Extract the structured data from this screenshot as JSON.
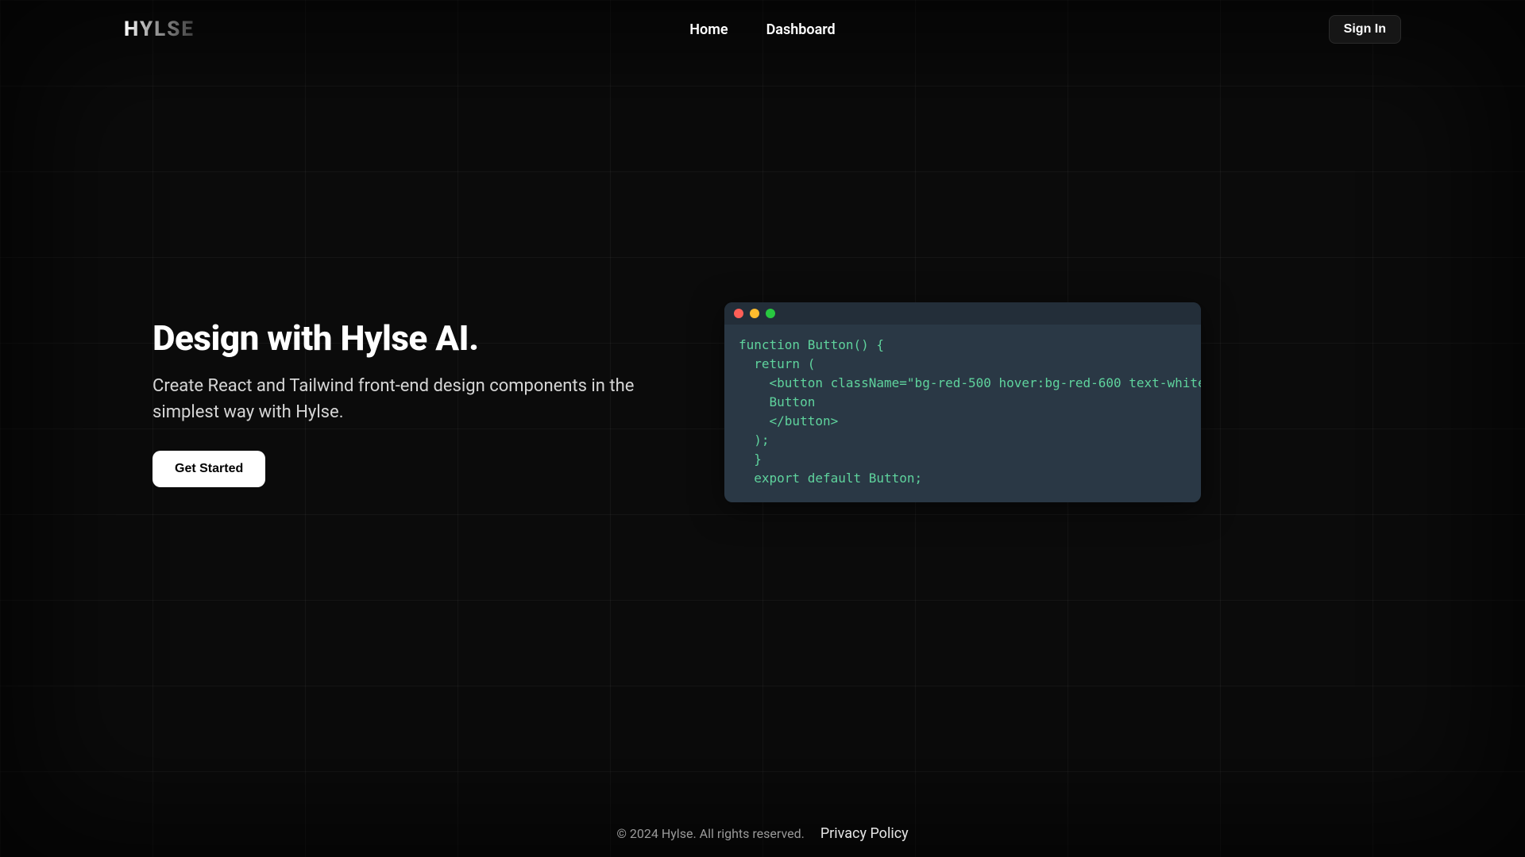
{
  "header": {
    "logo": "HYLSE",
    "nav": {
      "home": "Home",
      "dashboard": "Dashboard"
    },
    "signin": "Sign In"
  },
  "hero": {
    "headline": "Design with Hylse AI.",
    "subhead": "Create React and Tailwind front-end design components in the simplest way with Hylse.",
    "cta": "Get Started"
  },
  "code_window": {
    "lines": [
      "function Button() {",
      "  return (",
      "    <button className=\"bg-red-500 hover:bg-red-600 text-white",
      "    Button",
      "    </button>",
      "  );",
      "  }",
      "  export default Button;"
    ]
  },
  "footer": {
    "copyright": "© 2024 Hylse. All rights reserved.",
    "privacy": "Privacy Policy"
  },
  "colors": {
    "bg": "#0b0b0b",
    "code_bg": "#2a3845",
    "code_text": "#5fd39d"
  }
}
